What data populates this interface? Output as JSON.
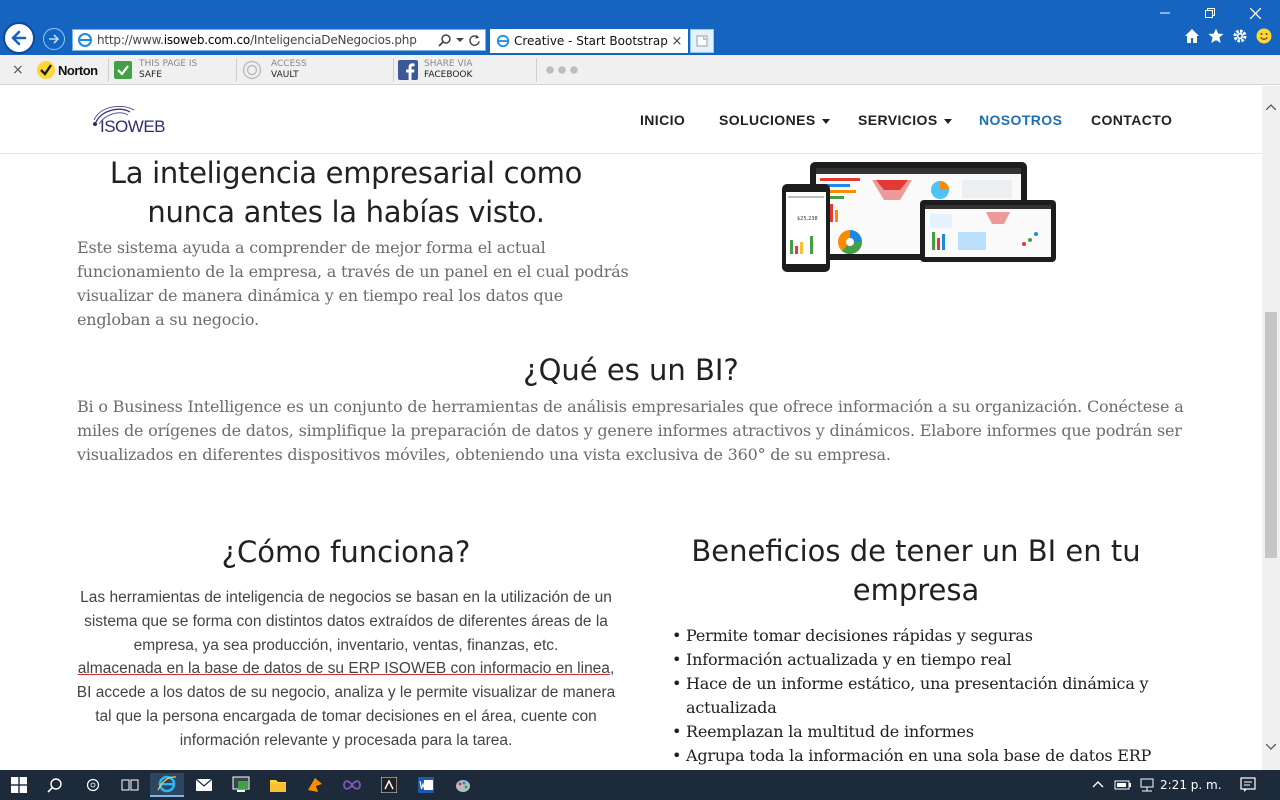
{
  "browser": {
    "url_prefix": "http://www.",
    "url_domain": "isoweb.com.co",
    "url_path": "/InteligenciaDeNegocios.php",
    "tab_title": "Creative - Start Bootstrap T...",
    "tab_close": "×"
  },
  "norton": {
    "close": "×",
    "brand": "Norton",
    "safe_top": "THIS PAGE IS",
    "safe_bottom": "SAFE",
    "vault_top": "ACCESS",
    "vault_bottom": "VAULT",
    "fb_top": "SHARE VIA",
    "fb_bottom": "FACEBOOK"
  },
  "site": {
    "logo_text": "ISOWEB",
    "nav": {
      "inicio": "INICIO",
      "soluciones": "SOLUCIONES",
      "servicios": "SERVICIOS",
      "nosotros": "NOSOTROS",
      "contacto": "CONTACTO"
    },
    "hero": {
      "title": "La inteligencia empresarial como nunca antes la habías visto.",
      "text": "Este sistema ayuda a comprender de mejor forma el actual funcionamiento de la empresa, a través de un panel en el cual podrás visualizar de manera dinámica y en tiempo real los datos que engloban a su negocio."
    },
    "bi": {
      "title": "¿Qué es un BI?",
      "text": "Bi o Business Intelligence es un conjunto de herramientas de análisis empresariales que ofrece información a su organización. Conéctese a miles de orígenes de datos, simplifique la preparación de datos y genere informes atractivos y dinámicos. Elabore informes que podrán ser visualizados en diferentes dispositivos móviles, obteniendo una vista exclusiva de 360° de su empresa."
    },
    "como": {
      "title": "¿Cómo funciona?",
      "text_1": "Las herramientas de inteligencia de negocios se basan en la utilización de un sistema que se forma con distintos datos extraídos de diferentes áreas de la empresa, ya sea producción, inventario, ventas, finanzas, etc.",
      "text_2": "almacenada en la base de datos de su ERP ISOWEB con informacio en linea",
      "text_3": ", BI accede a los datos de su negocio, analiza y le permite visualizar de manera tal que la persona encargada de tomar decisiones en el área, cuente con información relevante y procesada para la tarea."
    },
    "beneficios": {
      "title": "Beneficios de tener un BI en tu empresa",
      "items": [
        "Permite tomar decisiones rápidas y seguras",
        "Información actualizada y en tiempo real",
        "Hace de un informe estático, una presentación dinámica y actualizada",
        "Reemplazan la multitud de informes",
        "Agrupa toda la información en una sola base de datos ERP ISOWEB."
      ]
    },
    "device_mock": {
      "phone_value": "$25,238"
    }
  },
  "taskbar": {
    "clock": "2:21 p. m."
  },
  "colors": {
    "ie_blue": "#1565c0",
    "nav_active": "#1e6fb3",
    "taskbar": "#1c2a3a"
  }
}
